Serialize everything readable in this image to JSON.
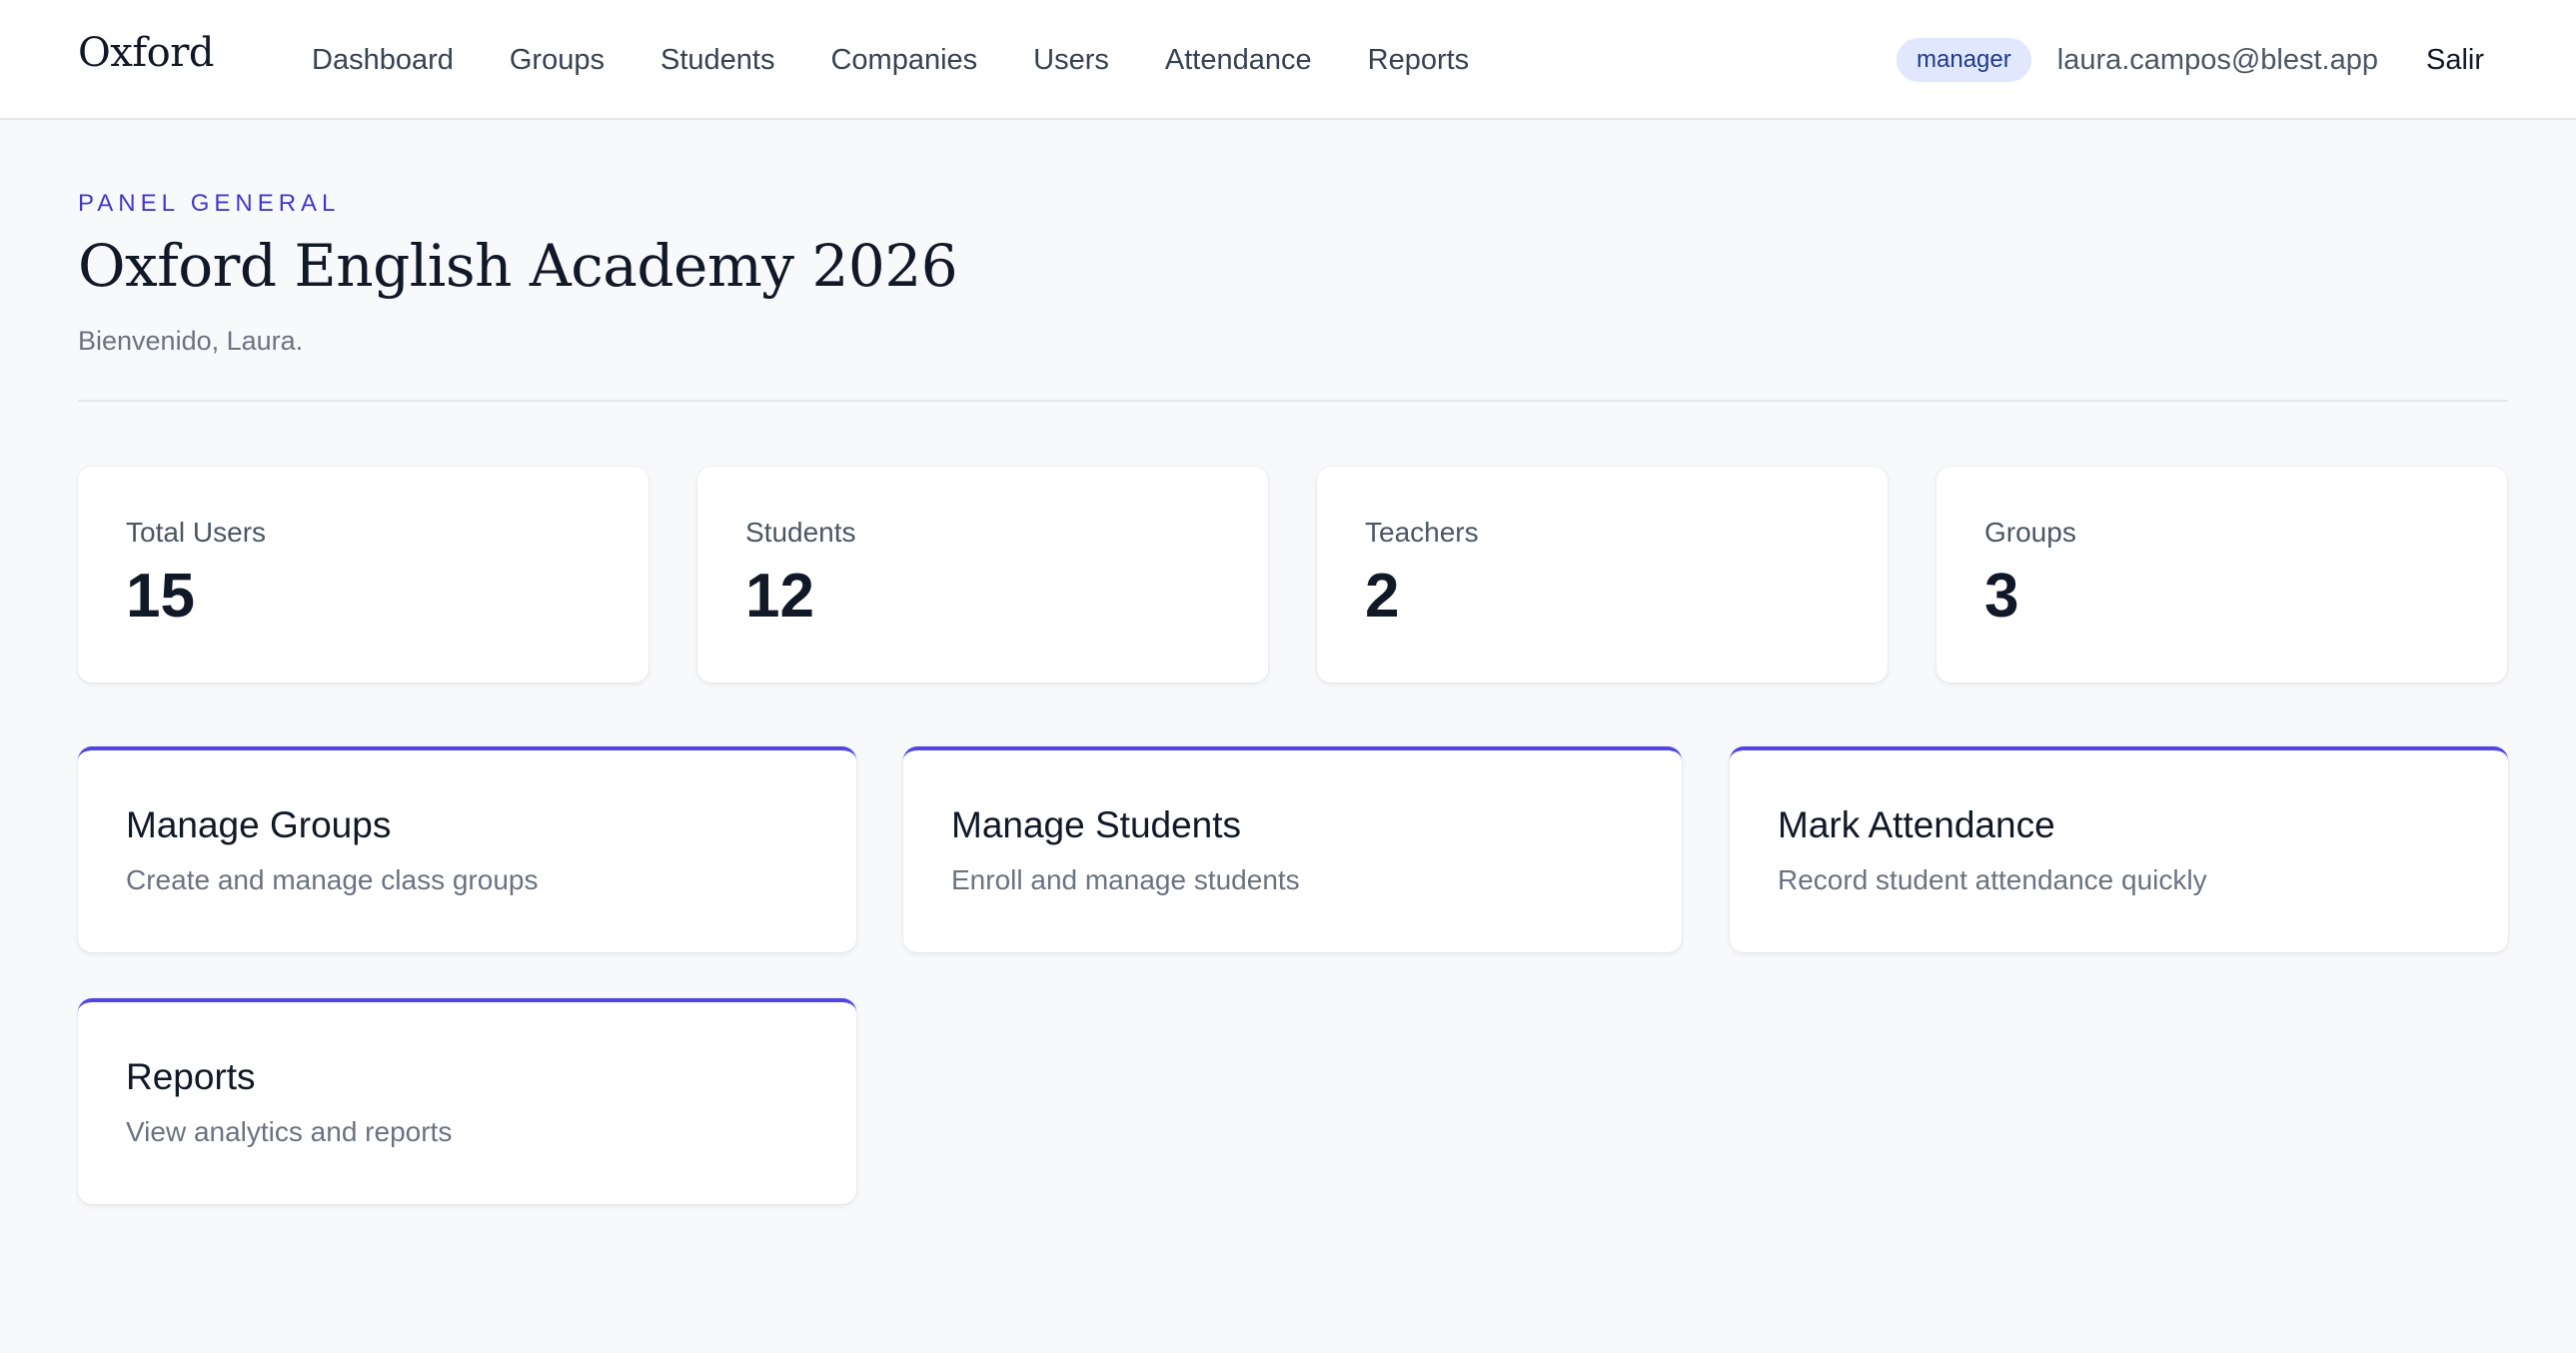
{
  "header": {
    "brand": "Oxford",
    "nav": [
      "Dashboard",
      "Groups",
      "Students",
      "Companies",
      "Users",
      "Attendance",
      "Reports"
    ],
    "role": "manager",
    "email": "laura.campos@blest.app",
    "logout": "Salir"
  },
  "page": {
    "eyebrow": "PANEL GENERAL",
    "title": "Oxford English Academy 2026",
    "subtitle": "Bienvenido, Laura."
  },
  "stats": [
    {
      "label": "Total Users",
      "value": "15"
    },
    {
      "label": "Students",
      "value": "12"
    },
    {
      "label": "Teachers",
      "value": "2"
    },
    {
      "label": "Groups",
      "value": "3"
    }
  ],
  "actions": [
    {
      "title": "Manage Groups",
      "desc": "Create and manage class groups"
    },
    {
      "title": "Manage Students",
      "desc": "Enroll and manage students"
    },
    {
      "title": "Mark Attendance",
      "desc": "Record student attendance quickly"
    },
    {
      "title": "Reports",
      "desc": "View analytics and reports"
    }
  ],
  "colors": {
    "accent": "#4f46e5",
    "eyebrow": "#4338ca",
    "badge_bg": "#e0e7ff",
    "background": "#f8f9fb"
  }
}
